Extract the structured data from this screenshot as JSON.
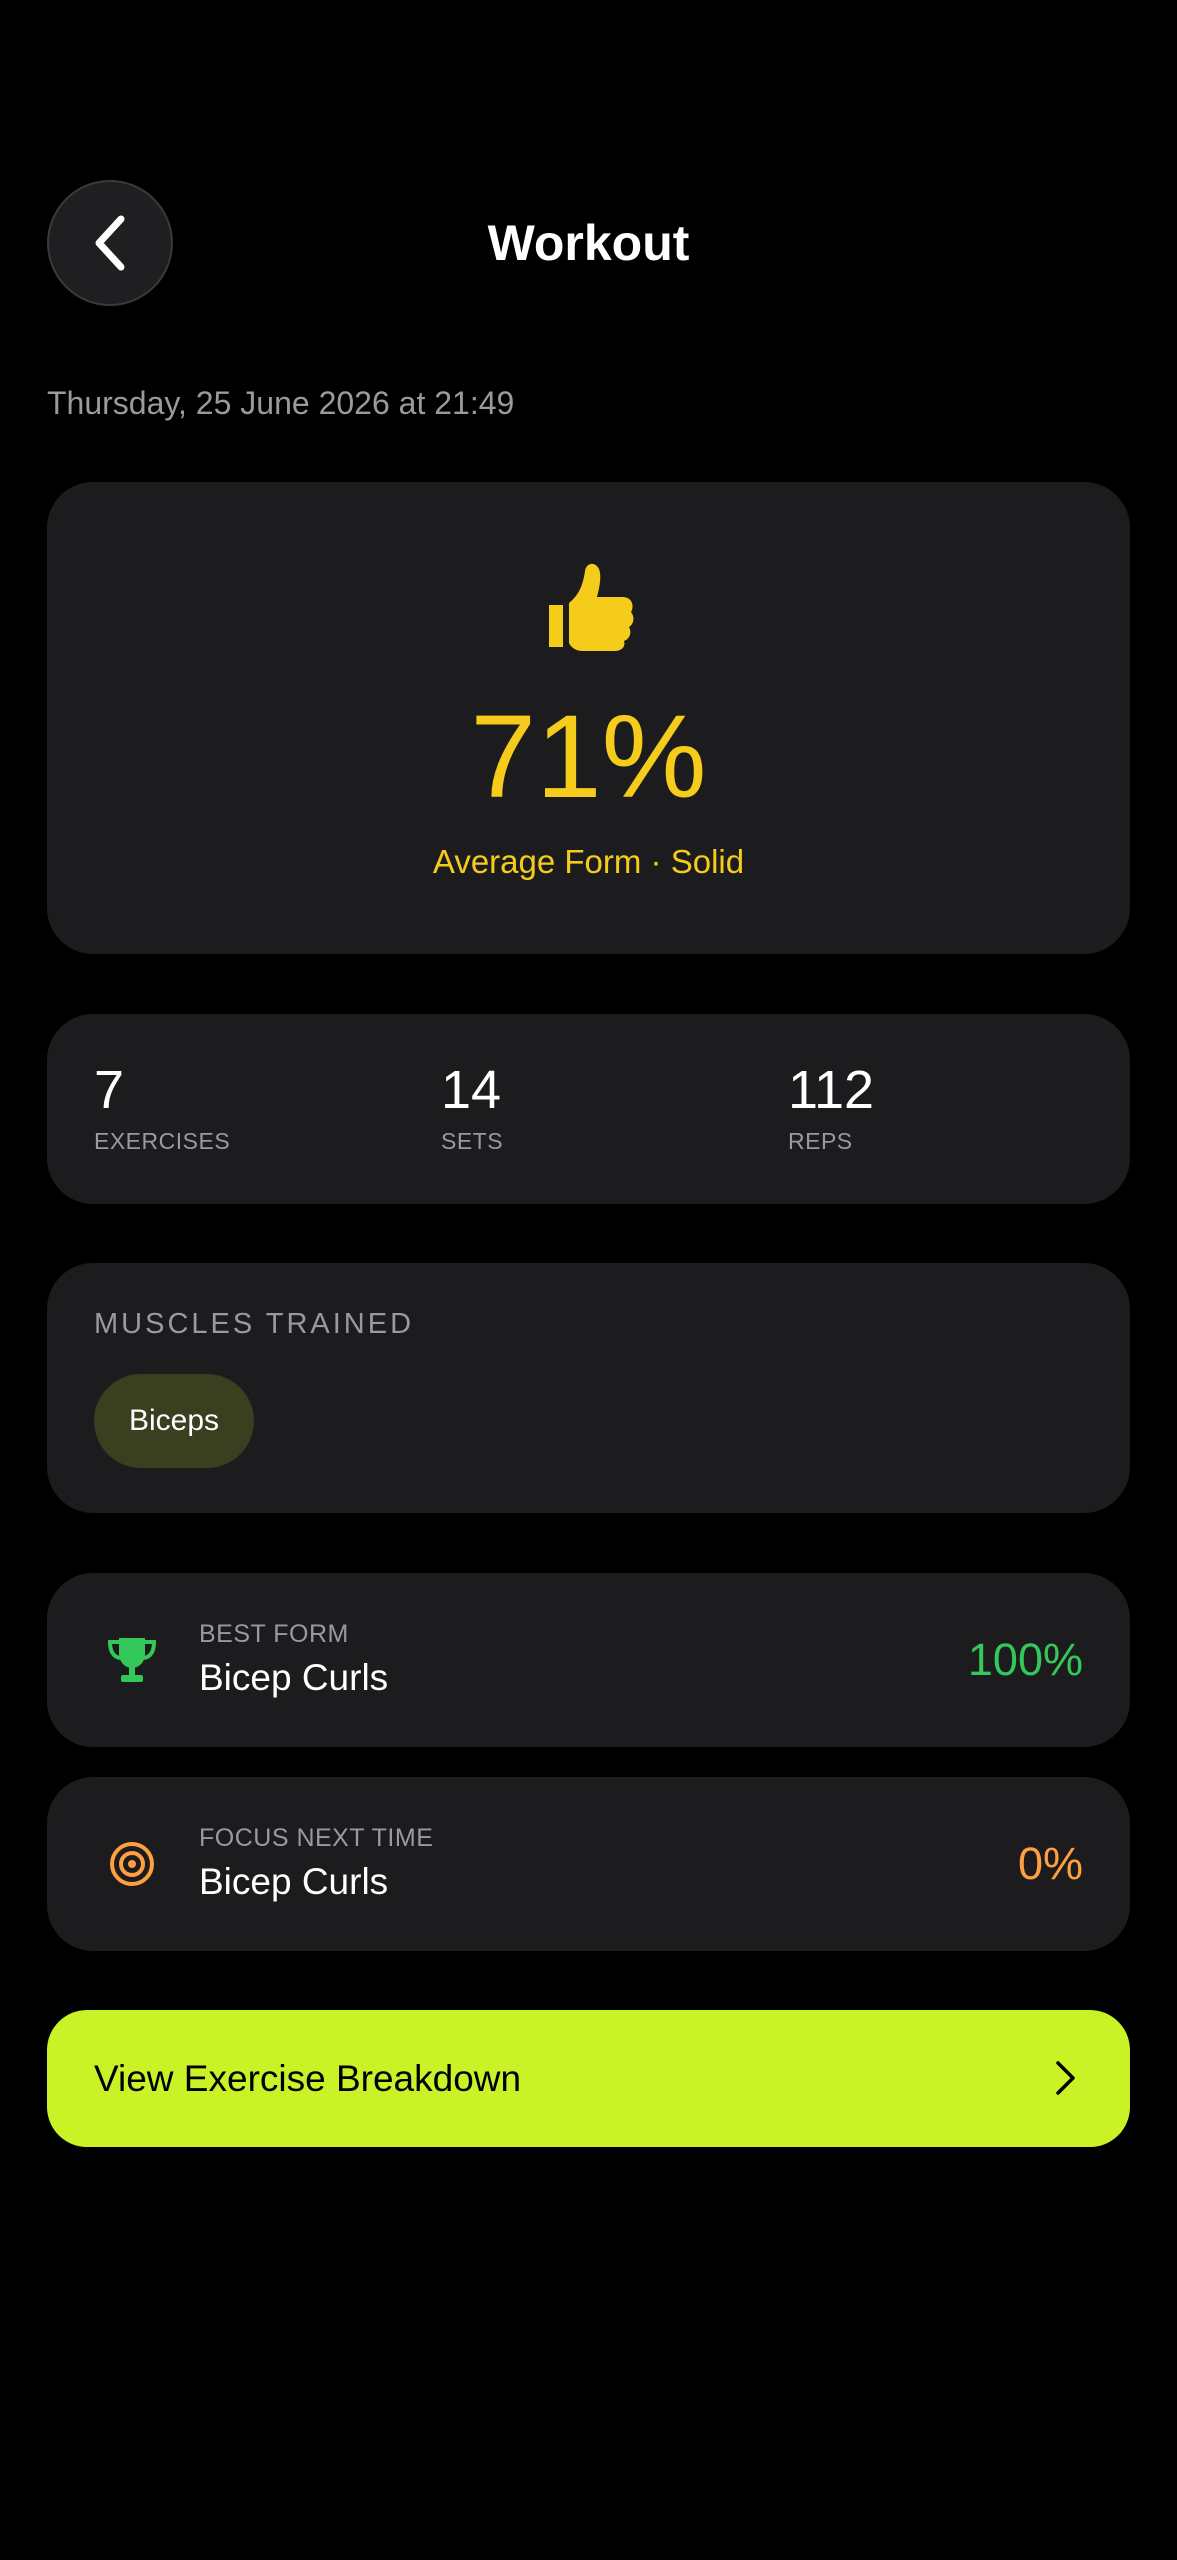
{
  "header": {
    "title": "Workout",
    "back_icon": "chevron-left-icon"
  },
  "date": "Thursday, 25 June 2026 at 21:49",
  "score": {
    "icon": "thumbs-up-icon",
    "value": "71%",
    "label": "Average Form · Solid",
    "color": "#f5cc1b"
  },
  "stats": [
    {
      "value": "7",
      "label": "EXERCISES"
    },
    {
      "value": "14",
      "label": "SETS"
    },
    {
      "value": "112",
      "label": "REPS"
    }
  ],
  "muscles": {
    "title": "MUSCLES TRAINED",
    "chips": [
      "Biceps"
    ]
  },
  "best": {
    "icon": "trophy-icon",
    "kicker": "BEST FORM",
    "name": "Bicep Curls",
    "percent": "100%",
    "color": "#34c759"
  },
  "focus": {
    "icon": "target-icon",
    "kicker": "FOCUS NEXT TIME",
    "name": "Bicep Curls",
    "percent": "0%",
    "color": "#ff9f40"
  },
  "cta": {
    "label": "View Exercise Breakdown",
    "icon": "chevron-right-icon",
    "color": "#c9f227"
  }
}
